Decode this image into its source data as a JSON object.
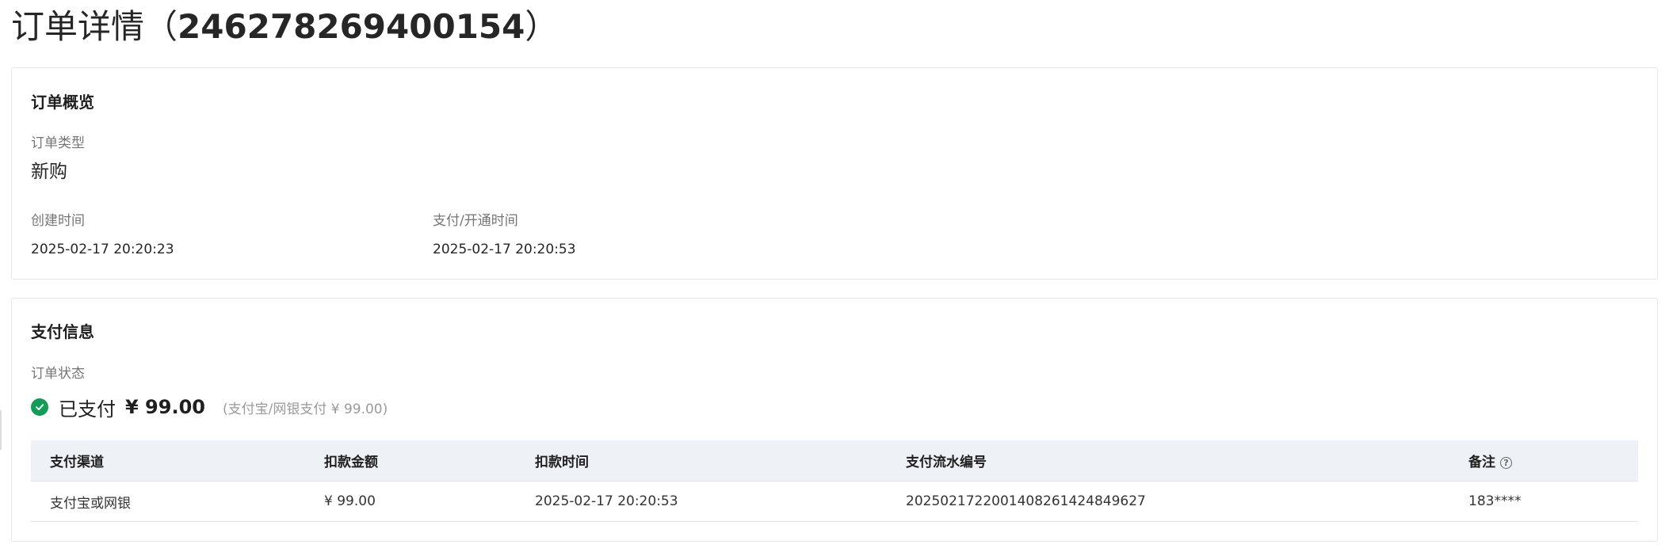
{
  "header": {
    "title_prefix": "订单详情（",
    "order_id": "246278269400154",
    "title_suffix": "）"
  },
  "overview": {
    "section_title": "订单概览",
    "order_type_label": "订单类型",
    "order_type_value": "新购",
    "created_time_label": "创建时间",
    "created_time_value": "2025-02-17 20:20:23",
    "paid_time_label": "支付/开通时间",
    "paid_time_value": "2025-02-17 20:20:53"
  },
  "payment": {
    "section_title": "支付信息",
    "status_label": "订单状态",
    "status_text": "已支付",
    "status_amount": "¥ 99.00",
    "status_detail": "(支付宝/网银支付 ¥ 99.00)",
    "status_color": "#0f9d58",
    "table": {
      "headers": [
        "支付渠道",
        "扣款金额",
        "扣款时间",
        "支付流水编号",
        "备注"
      ],
      "rows": [
        [
          "支付宝或网银",
          "¥ 99.00",
          "2025-02-17 20:20:53",
          "2025021722001408261424849627",
          "183****"
        ]
      ]
    },
    "help_icon": "question-circle-icon"
  }
}
